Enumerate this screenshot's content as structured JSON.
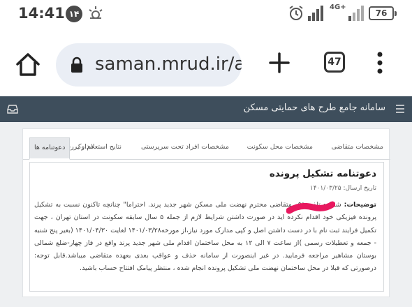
{
  "status_bar": {
    "time": "14:41",
    "notification_count": "۱۴",
    "network_type": "4G+",
    "battery": "76"
  },
  "browser": {
    "url": "saman.mrud.ir/a",
    "tab_count": "47"
  },
  "site": {
    "title": "سامانه جامع طرح های حمایتی مسکن"
  },
  "tabs": [
    {
      "label": "مشخصات متقاضی",
      "active": false
    },
    {
      "label": "مشخصات محل سکونت",
      "active": false
    },
    {
      "label": "مشخصات افراد تحت سرپرستی",
      "active": false
    },
    {
      "label": "نتایج استعلام و بررسی",
      "active": false
    },
    {
      "label": "مدارک",
      "active": false
    },
    {
      "label": "دعوتنامه ها",
      "active": true
    }
  ],
  "invitation": {
    "title": "دعوتنامه تشکیل پرونده",
    "send_date": "تاریخ ارسال: ۱۴۰۱/۰۳/۲۵",
    "description_label": "توضیحات:",
    "description_text": "شماره تلفن ۰۹۱ متقاضی محترم نهضت ملی مسکن شهر جدید پرند. احتراما\" چنانچه تاکنون نسبت به تشکیل پرونده فیزیکی خود اقدام نکرده اید در صورت داشتن شرایط لازم از جمله ۵ سال سابقه سکونت در استان تهران ، جهت تکمیل فرایند ثبت نام با در دست داشتن اصل و کپی مدارک مورد نیاز،از مورخه۱۴۰۱/۰۳/۲۸ لغایت ۱۴۰۱/۰۴/۳۰ (بغیر پنج شنبه - جمعه و تعطیلات رسمی )از ساعت ۷ الی ۱۲ به محل ساختمان اقدام ملی شهر جدید پرند واقع در فاز چهار-ضلع شمالی بوستان مشاهیر مراجعه فرمایید. در غیر اینصورت از سامانه حذف و عواقب بعدی بعهده متقاضی میباشد.قابل توجه: درصورتی که قبلا در محل ساختمان نهضت ملی تشکیل پرونده انجام شده ، منتظر پیامک افتتاح حساب باشید."
  },
  "colors": {
    "header_bg": "#3e4e5c",
    "content_bg": "#eef0f2",
    "redaction": "#e8185f"
  }
}
